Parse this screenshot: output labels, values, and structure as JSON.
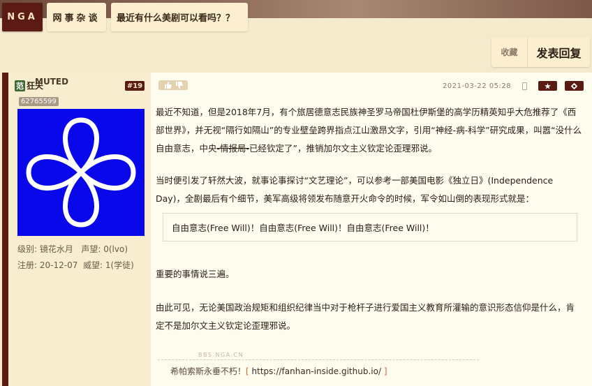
{
  "header": {
    "logo": "NGA",
    "forum": "网事杂谈",
    "thread_title": "最近有什么美剧可以看吗？？"
  },
  "actions": {
    "favorite": "收藏",
    "reply": "发表回复"
  },
  "post": {
    "badge": "范",
    "username": "狂夫",
    "username_muted": "MUTED",
    "floor": "#19",
    "uid": "62765599",
    "level_label": "级别:",
    "level_value": "镜花水月",
    "reputation_label": "声望:",
    "reputation_value": "0(lvo)",
    "register_label": "注册:",
    "register_value": "20-12-07",
    "prestige_label": "威望:",
    "prestige_value": "1(学徒)",
    "time": "2021-03-22 05:28",
    "p1_a": "最近不知道，但是2018年7月，有个旅居德意志民族神圣罗马帝国杜伊斯堡的高学历精英知乎大危推荐了《西部世界》，并无视“隔行如隔山”的专业壁垒跨界指点江山激昂文字，引用“神经-病-科学”研究成果，叫嚣“没什么自由意志，中央",
    "p1_strike": "-情报局-",
    "p1_b": "已经钦定了”，推销加尔文主义钦定论歪理邪说。",
    "p2": "当时便引发了轩然大波，就事论事探讨“文艺理论”，可以参考一部美国电影《独立日》(Independence Day)，全剧最后有个细节，美军高级将领发布随意开火命令的时候，军令如山倒的表现形式就是：",
    "quote": "自由意志(Free Will)！自由意志(Free Will)！自由意志(Free Will)！",
    "p3": "重要的事情说三遍。",
    "p4": "由此可见，无论美国政治规矩和组织纪律当中对于枪杆子进行爱国主义教育所灌输的意识形态信仰是什么，肯定不是加尔文主义钦定论歪理邪说。",
    "watermark": "BBS.NGA.CN",
    "signature_text": "希帕索斯永垂不朽！",
    "signature_link": "https://fanhan-inside.github.io/",
    "bracket_open": "[",
    "bracket_close": "]"
  },
  "colors": {
    "brand_dark": "#5a1b13",
    "page_bg": "#f5ebcc",
    "avatar_bg": "#0808ea"
  }
}
